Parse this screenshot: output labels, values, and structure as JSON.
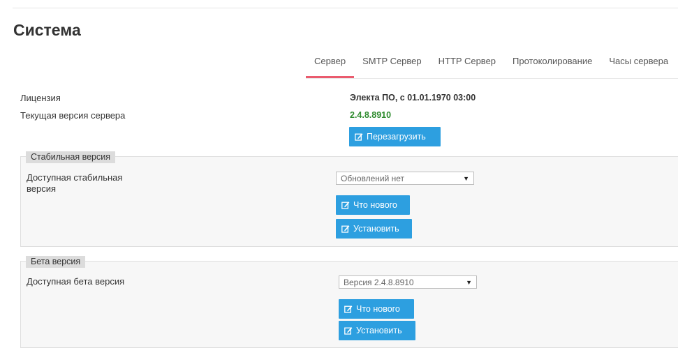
{
  "page": {
    "title": "Система"
  },
  "tabs": [
    {
      "label": "Сервер",
      "active": true
    },
    {
      "label": "SMTP Сервер",
      "active": false
    },
    {
      "label": "HTTP Сервер",
      "active": false
    },
    {
      "label": "Протоколирование",
      "active": false
    },
    {
      "label": "Часы сервера",
      "active": false
    }
  ],
  "info": {
    "license_label": "Лицензия",
    "license_value": "Электа ПО, с 01.01.1970 03:00",
    "version_label": "Текущая версия сервера",
    "version_value": "2.4.8.8910",
    "restart_label": "Перезагрузить"
  },
  "stable": {
    "legend": "Стабильная версия",
    "label_line1": "Доступная стабильная",
    "label_line2": "версия",
    "select_value": "Обновлений нет",
    "whats_new_label": "Что нового",
    "install_label": "Установить"
  },
  "beta": {
    "legend": "Бета версия",
    "label": "Доступная бета версия",
    "select_value": "Версия 2.4.8.8910",
    "whats_new_label": "Что нового",
    "install_label": "Установить"
  },
  "colors": {
    "accent_blue": "#2d9fe0",
    "tab_active_underline": "#ea5b6e",
    "version_green": "#2e8b2e"
  },
  "icons": {
    "button_icon": "edit-icon",
    "select_icon": "caret-down-icon"
  }
}
